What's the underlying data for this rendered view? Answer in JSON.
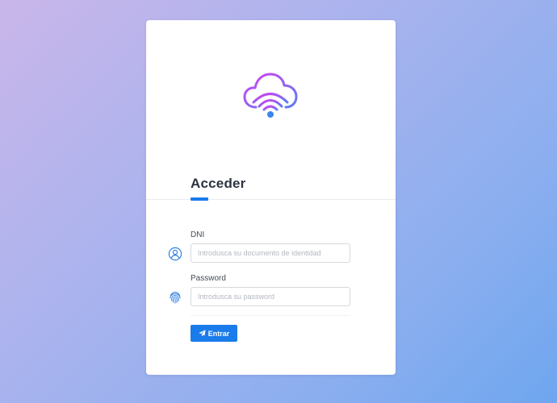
{
  "colors": {
    "accent": "#1a7bea",
    "logo_gradient_start": "#d63ef0",
    "logo_gradient_end": "#5a7ef2",
    "logo_dot": "#3a86ea"
  },
  "logo": {
    "icon": "cloud-wifi-icon"
  },
  "login": {
    "title": "Acceder",
    "dni": {
      "label": "DNI",
      "placeholder": "Introdusca su documento de identidad",
      "value": "",
      "icon": "user-circle-icon"
    },
    "password": {
      "label": "Password",
      "placeholder": "Introdusca su password",
      "value": "",
      "icon": "fingerprint-icon"
    },
    "submit": {
      "label": "Entrar",
      "icon": "paper-plane-icon"
    }
  }
}
